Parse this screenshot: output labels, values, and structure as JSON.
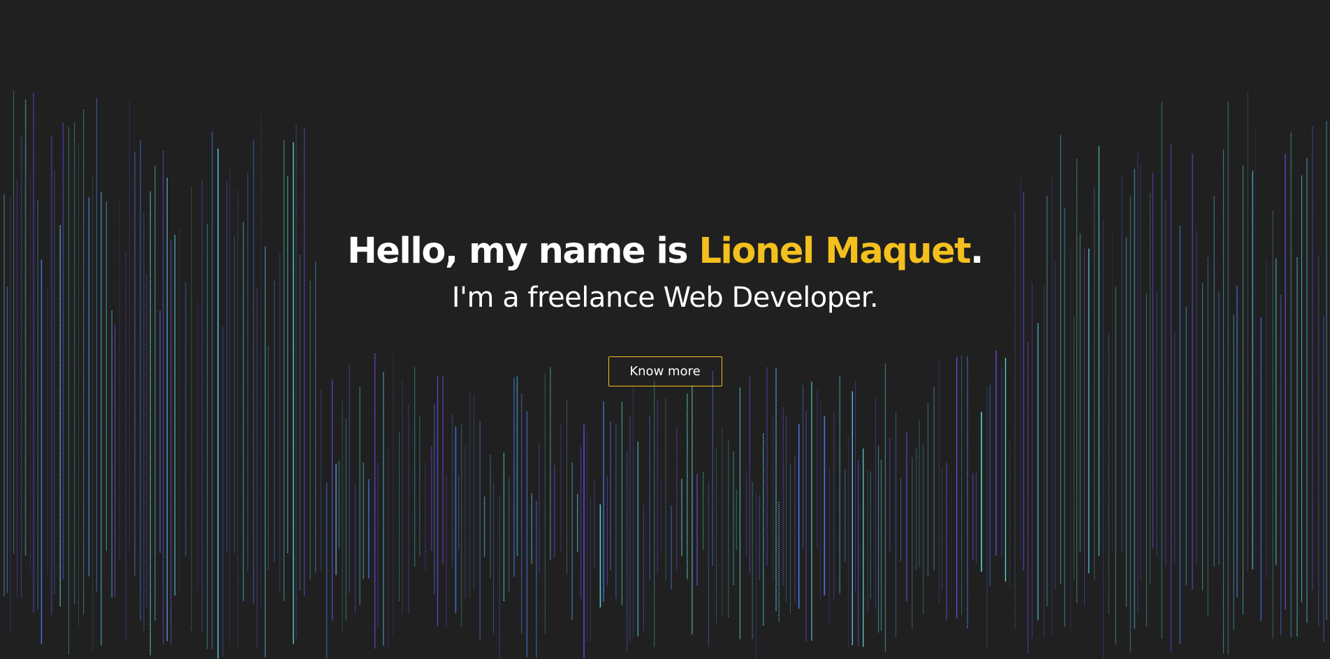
{
  "hero": {
    "greeting_prefix": "Hello, my name is ",
    "name": "Lionel Maquet",
    "greeting_suffix": ".",
    "tagline": "I'm a freelance Web Developer.",
    "cta_label": "Know more"
  },
  "theme": {
    "background": "#202020",
    "accent": "#f4c01e",
    "text": "#ffffff",
    "line_colors": [
      "#5ee6e0",
      "#4a7df0",
      "#6a4cf2",
      "#56c8e8"
    ]
  }
}
